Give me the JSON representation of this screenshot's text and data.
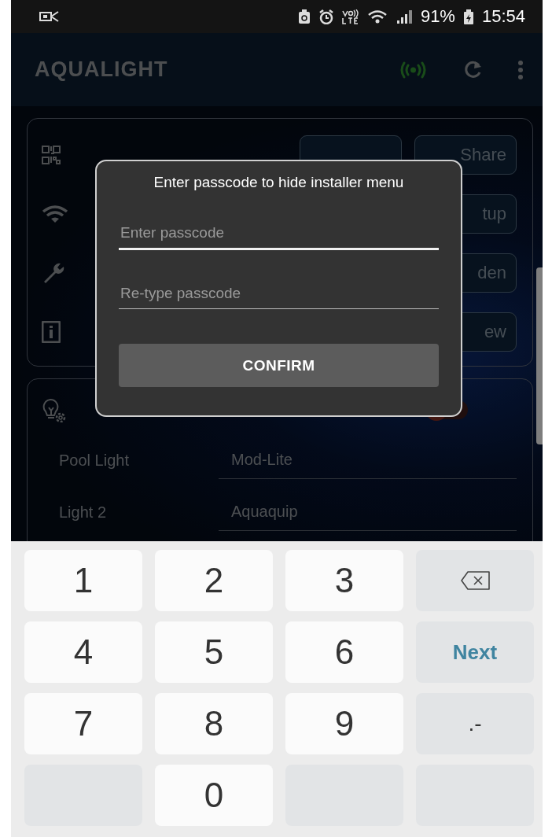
{
  "status_bar": {
    "battery": "91%",
    "time": "15:54"
  },
  "app_bar": {
    "title": "AQUALIGHT"
  },
  "settings_card": {
    "rows": [
      {
        "kind": "qr",
        "button": "Share"
      },
      {
        "kind": "wifi",
        "button": "tup"
      },
      {
        "kind": "wrench",
        "button": "den"
      },
      {
        "kind": "info",
        "button": "ew"
      }
    ]
  },
  "lights_card": {
    "toggle_on": false,
    "lights": [
      {
        "name": "Pool Light",
        "value": "Mod-Lite"
      },
      {
        "name": "Light 2",
        "value": "Aquaquip"
      }
    ]
  },
  "dialog": {
    "title": "Enter passcode to hide installer menu",
    "fields": [
      {
        "placeholder": "Enter passcode",
        "focused": true
      },
      {
        "placeholder": "Re-type passcode",
        "focused": false
      }
    ],
    "button": "CONFIRM"
  },
  "keyboard": {
    "keys": [
      {
        "kind": "digit",
        "label": "1"
      },
      {
        "kind": "digit",
        "label": "2"
      },
      {
        "kind": "digit",
        "label": "3"
      },
      {
        "kind": "backspace"
      },
      {
        "kind": "digit",
        "label": "4"
      },
      {
        "kind": "digit",
        "label": "5"
      },
      {
        "kind": "digit",
        "label": "6"
      },
      {
        "kind": "action",
        "label": "Next"
      },
      {
        "kind": "digit",
        "label": "7"
      },
      {
        "kind": "digit",
        "label": "8"
      },
      {
        "kind": "digit",
        "label": "9"
      },
      {
        "kind": "symbol",
        "label": ".-"
      },
      {
        "kind": "blank"
      },
      {
        "kind": "digit",
        "label": "0"
      },
      {
        "kind": "blank"
      },
      {
        "kind": "blank"
      }
    ]
  }
}
